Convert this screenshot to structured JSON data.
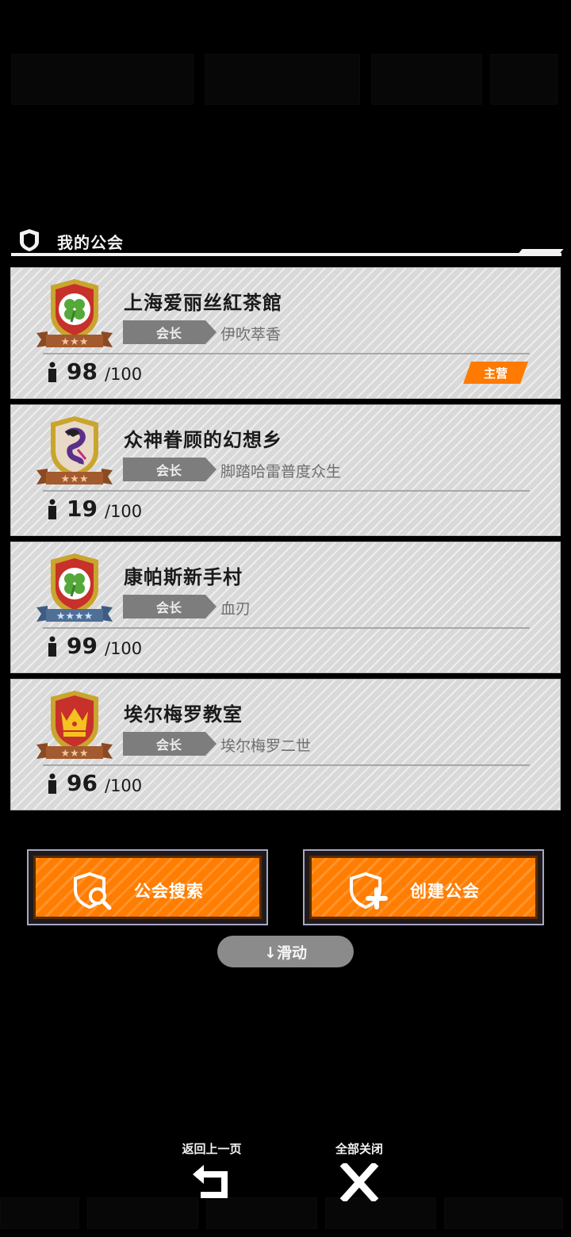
{
  "header": {
    "title": "我的公会",
    "icon": "shield-icon"
  },
  "guilds": [
    {
      "name": "上海爱丽丝紅茶館",
      "role_label": "会长",
      "leader": "伊吹萃香",
      "members": "98",
      "capacity": "/100",
      "badge": "主营",
      "stars": 3,
      "emblem": "clover-emblem-icon",
      "ribbon_color": "#a35a2e"
    },
    {
      "name": "众神眷顾的幻想乡",
      "role_label": "会长",
      "leader": "脚踏哈雷普度众生",
      "members": "19",
      "capacity": "/100",
      "badge": "",
      "stars": 3,
      "emblem": "serpent-emblem-icon",
      "ribbon_color": "#a35a2e"
    },
    {
      "name": "康帕斯新手村",
      "role_label": "会长",
      "leader": "血刃",
      "members": "99",
      "capacity": "/100",
      "badge": "",
      "stars": 4,
      "emblem": "clover-emblem-icon",
      "ribbon_color": "#4f6f96"
    },
    {
      "name": "埃尔梅罗教室",
      "role_label": "会长",
      "leader": "埃尔梅罗二世",
      "members": "96",
      "capacity": "/100",
      "badge": "",
      "stars": 3,
      "emblem": "crown-emblem-icon",
      "ribbon_color": "#a35a2e"
    }
  ],
  "actions": {
    "search_label": "公会搜索",
    "create_label": "创建公会",
    "scroll_label": "↓滑动"
  },
  "controls": {
    "back_label": "返回上一页",
    "close_all_label": "全部关闭"
  },
  "colors": {
    "accent": "#ff7d00",
    "card_bg": "#d9d9d9",
    "tag_gray": "#7d7d7d"
  }
}
